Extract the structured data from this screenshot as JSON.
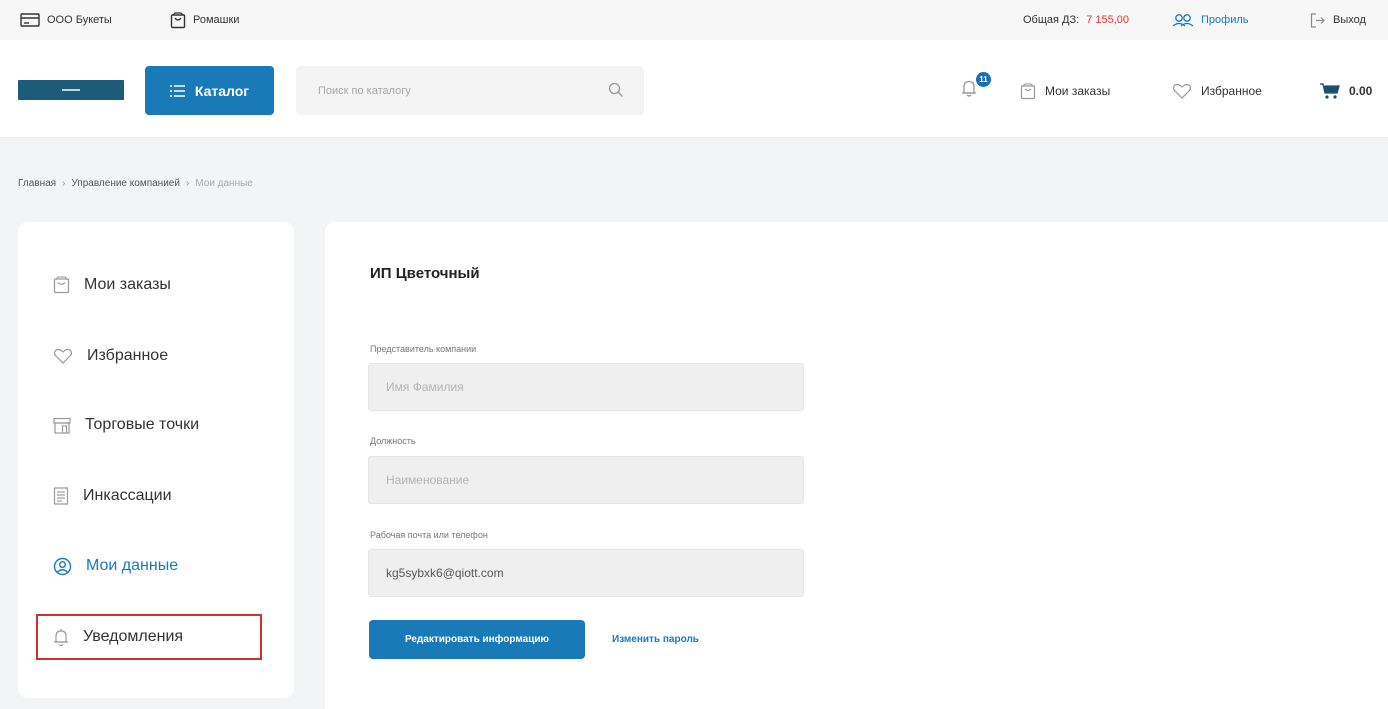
{
  "topbar": {
    "company": "ООО Букеты",
    "store": "Ромашки",
    "debt_label": "Общая ДЗ:",
    "debt_value": "7 155,00",
    "profile": "Профиль",
    "logout": "Выход"
  },
  "header": {
    "catalog_label": "Каталог",
    "search_placeholder": "Поиск по каталогу",
    "notification_count": "11",
    "orders_label": "Мои заказы",
    "favorites_label": "Избранное",
    "cart_total": "0.00"
  },
  "breadcrumb": {
    "items": [
      "Главная",
      "Управление компанией",
      "Мои данные"
    ],
    "separator": "›"
  },
  "sidebar": {
    "items": [
      {
        "label": "Мои заказы",
        "icon": "bag-icon"
      },
      {
        "label": "Избранное",
        "icon": "heart-icon"
      },
      {
        "label": "Торговые точки",
        "icon": "store-icon"
      },
      {
        "label": "Инкассации",
        "icon": "document-icon"
      },
      {
        "label": "Мои данные",
        "icon": "user-icon"
      },
      {
        "label": "Уведомления",
        "icon": "bell-icon"
      }
    ],
    "active_item": "Мои данные",
    "highlighted_item": "Уведомления"
  },
  "profile_form": {
    "company_name": "ИП Цветочный",
    "representative_label": "Представитель компании",
    "representative_placeholder": "Имя Фамилия",
    "position_label": "Должность",
    "position_placeholder": "Наименование",
    "contact_label": "Рабочая почта или телефон",
    "contact_value": "kg5sybxk6@qiott.com",
    "edit_button": "Редактировать информацию",
    "change_password": "Изменить пароль"
  },
  "colors": {
    "accent": "#1a7ab8",
    "debt": "#e53935",
    "highlight_border": "#d32f2f"
  }
}
